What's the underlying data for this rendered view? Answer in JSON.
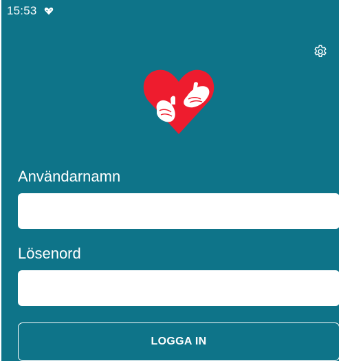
{
  "status_bar": {
    "time": "15:53",
    "icon": "heart-hands-notification-icon"
  },
  "toolbar": {
    "settings_icon": "gear-icon"
  },
  "logo": {
    "icon": "heart-hug-logo",
    "heart_color": "#ee1c2e",
    "hand_color": "#ffffff"
  },
  "form": {
    "username_label": "Användarnamn",
    "username_value": "",
    "password_label": "Lösenord",
    "password_value": "",
    "login_label": "LOGGA IN"
  },
  "colors": {
    "background": "#0e7489",
    "text": "#ffffff"
  }
}
